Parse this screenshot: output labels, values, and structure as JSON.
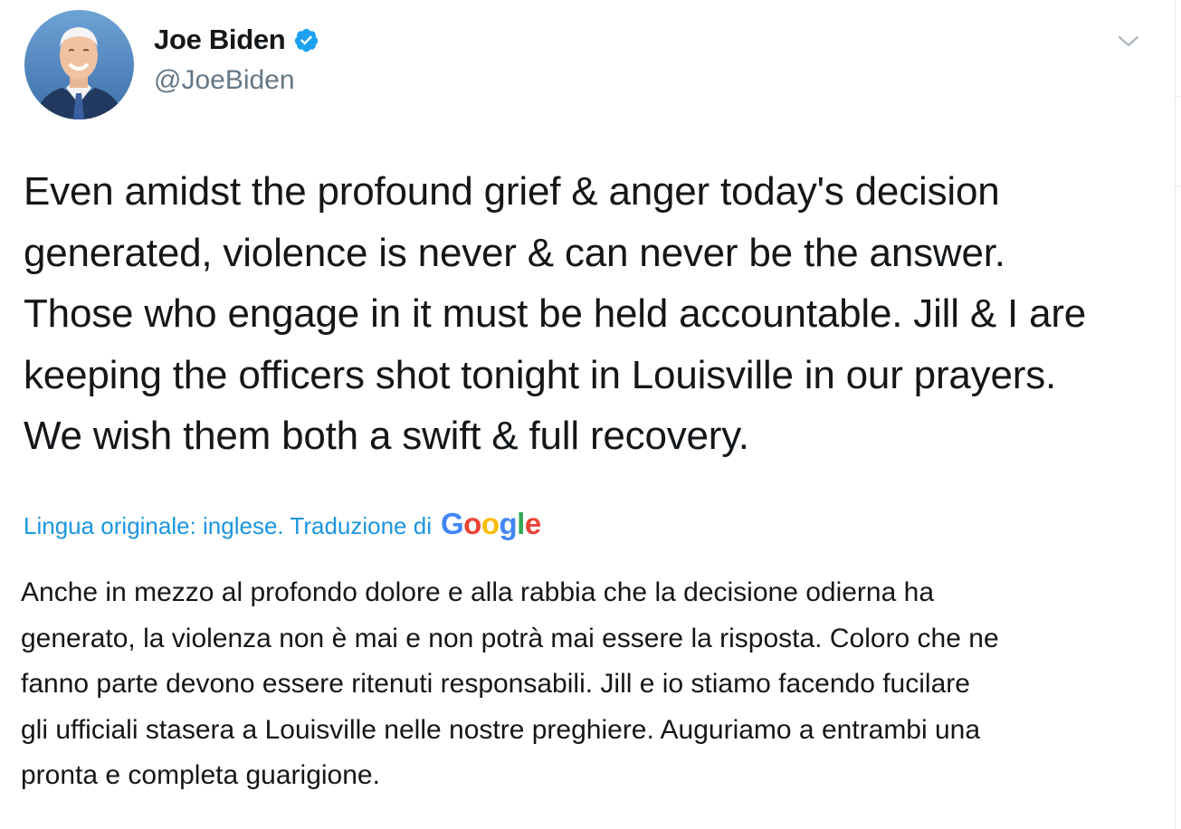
{
  "author": {
    "display_name": "Joe Biden",
    "handle": "@JoeBiden",
    "verified": true,
    "avatar_icon": "profile-photo"
  },
  "menu": {
    "icon": "chevron-down-icon"
  },
  "tweet": {
    "lines": [
      "Even amidst the profound grief & anger today's decision",
      "generated, violence is never & can never be the answer.",
      "Those who engage in it must be held accountable. Jill & I are",
      "keeping the officers shot tonight in Louisville in our prayers.",
      "We wish them both a swift & full recovery."
    ]
  },
  "translation": {
    "label": "Lingua originale: inglese. Traduzione di",
    "provider": "Google",
    "link_color": "#1b95e0",
    "lines": [
      "Anche in mezzo al profondo dolore e alla rabbia che la decisione odierna ha",
      "generato, la violenza non è mai e non potrà mai essere la risposta. Coloro che ne",
      "fanno parte devono essere ritenuti responsabili. Jill e io stiamo facendo fucilare",
      "gli ufficiali stasera a Louisville nelle nostre preghiere. Auguriamo a entrambi una",
      "pronta e completa guarigione."
    ]
  },
  "colors": {
    "text": "#14171a",
    "secondary": "#657786",
    "verified": "#1da1f2",
    "google_blue": "#4285f4",
    "google_red": "#ea4335",
    "google_yellow": "#fbbc05",
    "google_green": "#34a853"
  }
}
